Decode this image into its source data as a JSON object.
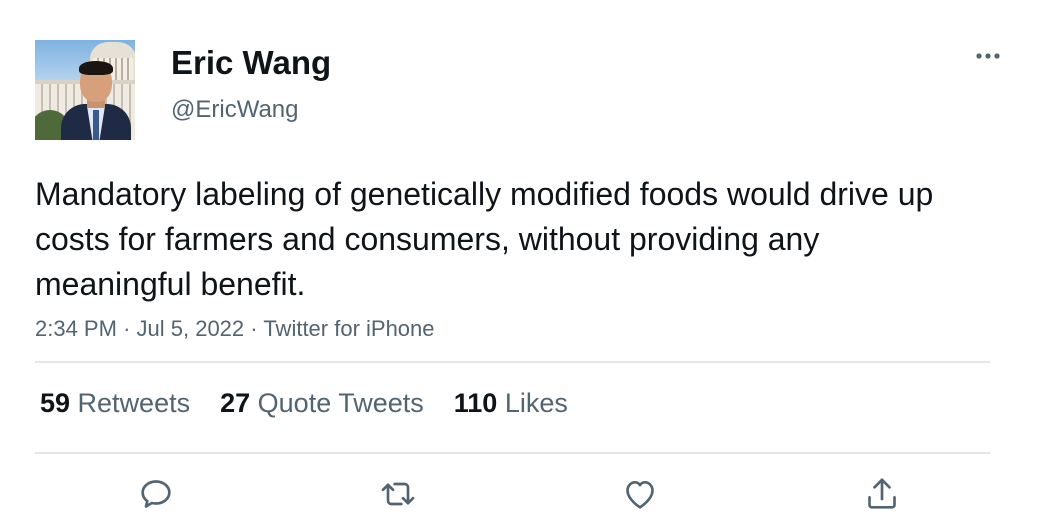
{
  "author": {
    "display_name": "Eric Wang",
    "handle": "@EricWang"
  },
  "tweet": {
    "text": "Mandatory labeling of genetically modified foods would drive up costs for farmers and consumers, without providing any meaningful benefit.",
    "time": "2:34 PM",
    "date": "Jul 5, 2022",
    "source": "Twitter for iPhone",
    "separator": "·"
  },
  "stats": {
    "retweets_count": "59",
    "retweets_label": "Retweets",
    "quote_count": "27",
    "quote_label": "Quote Tweets",
    "likes_count": "110",
    "likes_label": "Likes"
  },
  "icons": {
    "more": "more-horizontal-icon",
    "reply": "reply-icon",
    "retweet": "retweet-icon",
    "like": "heart-icon",
    "share": "share-icon"
  },
  "colors": {
    "text": "#0f1419",
    "secondary": "#536471",
    "divider": "#e4e7ea"
  }
}
